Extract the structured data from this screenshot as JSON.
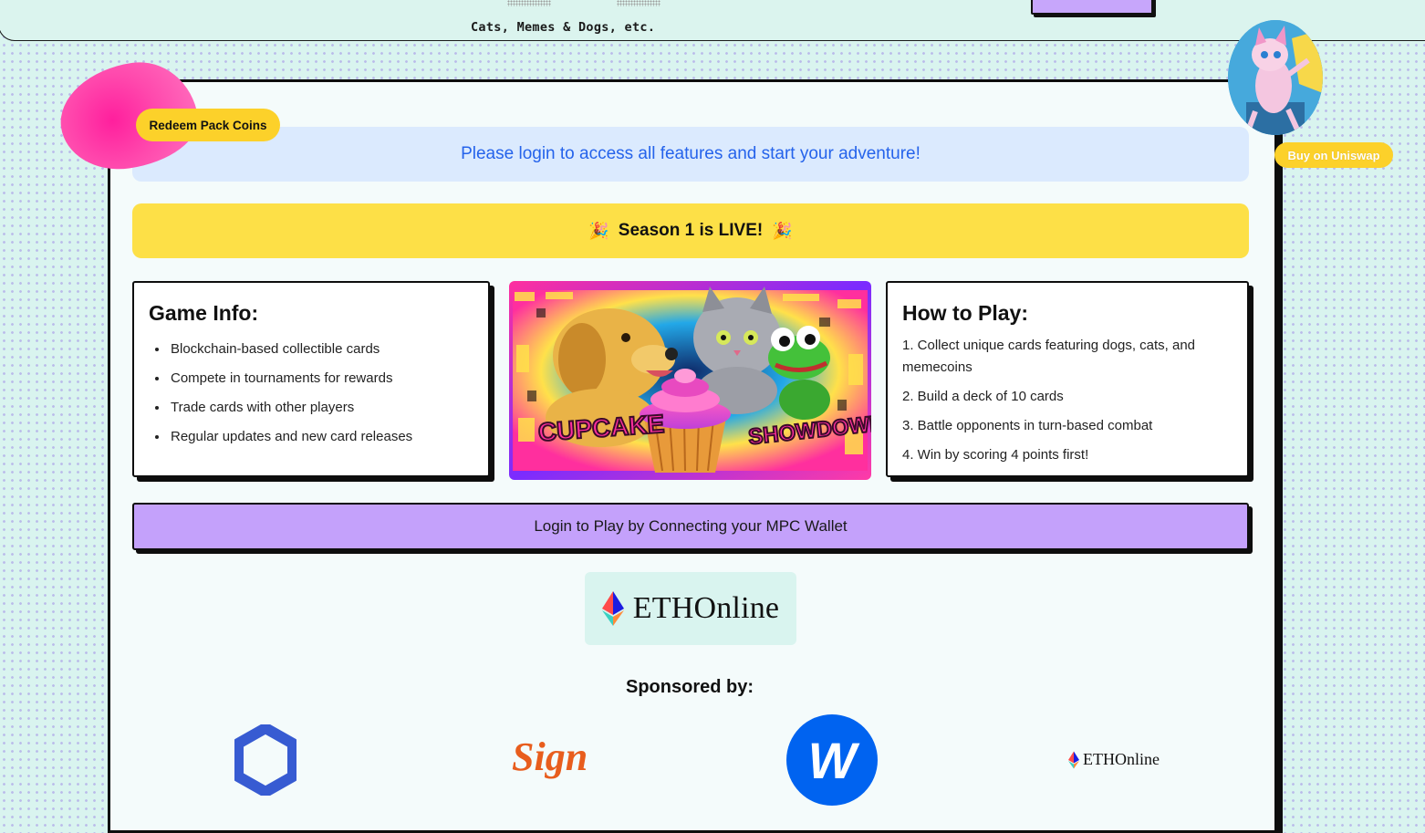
{
  "header": {
    "subtitle": "Cats, Memes & Dogs, etc."
  },
  "redeem_button": {
    "label": "Redeem Pack Coins"
  },
  "uniswap_button": {
    "label": "Buy on Uniswap"
  },
  "login_banner": {
    "text": "Please login to access all features and start your adventure!"
  },
  "season_banner": {
    "text": "Season 1 is LIVE!",
    "emoji": "🎉"
  },
  "game_info": {
    "title": "Game Info:",
    "items": [
      "Blockchain-based collectible cards",
      "Compete in tournaments for rewards",
      "Trade cards with other players",
      "Regular updates and new card releases"
    ]
  },
  "artwork": {
    "left_word": "CUPCAKE",
    "right_word": "SHOWDOWN"
  },
  "how_to_play": {
    "title": "How to Play:",
    "steps": [
      "1. Collect unique cards featuring dogs, cats, and memecoins",
      "2. Build a deck of 10 cards",
      "3. Battle opponents in turn-based combat",
      "4. Win by scoring 4 points first!"
    ]
  },
  "connect_button": {
    "label": "Login to Play by Connecting your MPC Wallet"
  },
  "eth_logo": {
    "text": "ETHOnline"
  },
  "sponsors": {
    "heading": "Sponsored by:",
    "items": [
      {
        "name": "chainlink-logo"
      },
      {
        "name": "sign-logo",
        "text": "Sign"
      },
      {
        "name": "w-logo",
        "text": "W"
      },
      {
        "name": "ethonline-logo",
        "text": "ETHOnline"
      }
    ]
  },
  "colors": {
    "accent_purple": "#c4a1fb",
    "accent_yellow": "#fde047",
    "banner_blue": "#dbeafe",
    "link_blue": "#2563eb",
    "blob_pink": "#ff2fa3"
  }
}
